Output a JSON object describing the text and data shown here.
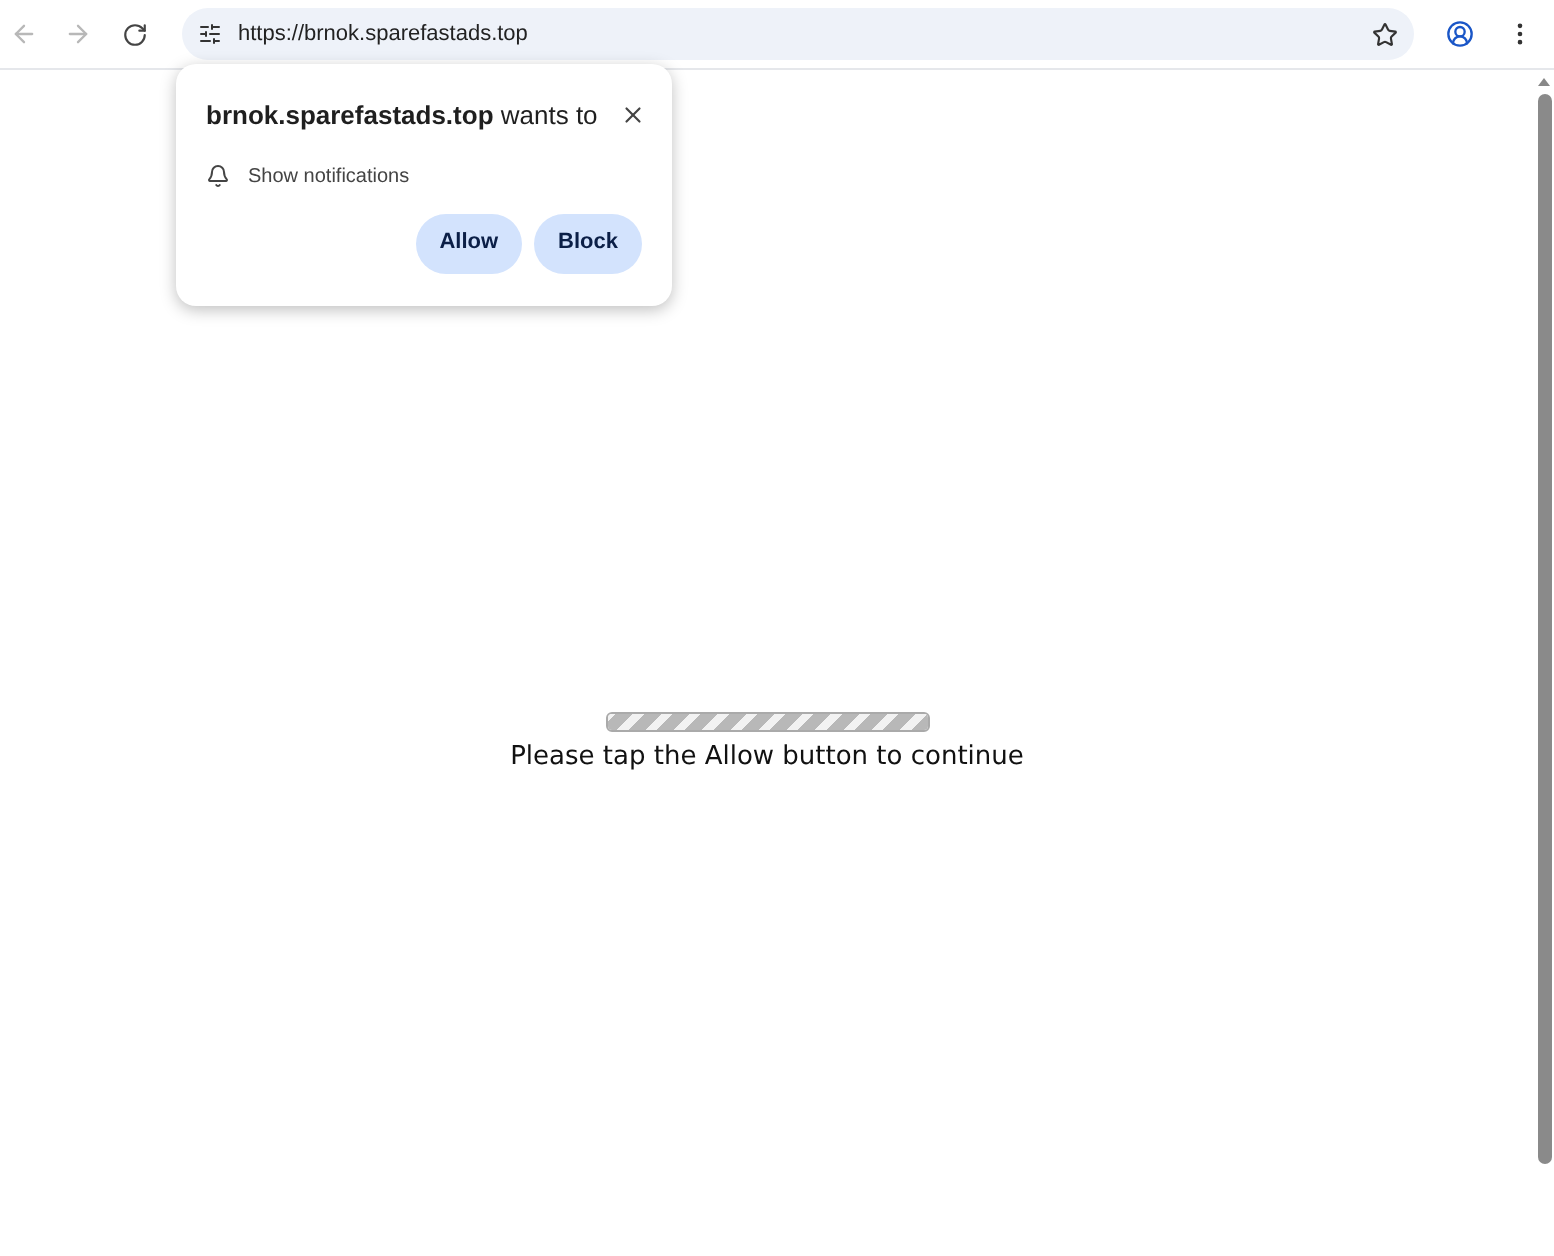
{
  "toolbar": {
    "url": "https://brnok.sparefastads.top"
  },
  "permission_popup": {
    "title": "**brnok.sparefastads.top** wants to",
    "permission": "Show notifications",
    "buttons": [
      "Allow",
      "Block"
    ]
  },
  "page": {
    "progress": {
      "level": 1
    },
    "message": "Please tap the Allow button to continue"
  }
}
